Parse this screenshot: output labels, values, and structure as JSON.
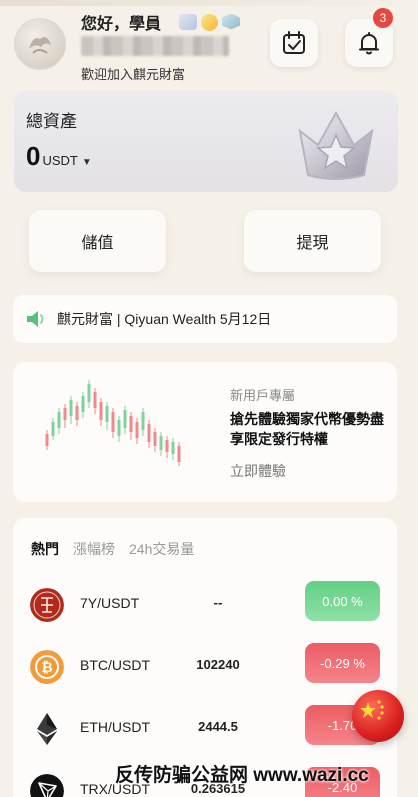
{
  "header": {
    "greeting": "您好，學員",
    "welcome": "歡迎加入麒元財富",
    "notification_count": "3"
  },
  "assets": {
    "label": "總資產",
    "value": "0",
    "unit": "USDT"
  },
  "actions": {
    "deposit_label": "儲值",
    "withdraw_label": "提現"
  },
  "announcement": {
    "text": "麒元財富 | Qiyuan Wealth 5月12日"
  },
  "promo": {
    "tag": "新用戶專屬",
    "title": "搶先體驗獨家代幣優勢盡享限定發行特權",
    "link": "立即體驗"
  },
  "market": {
    "tabs": [
      "熱門",
      "漲幅榜",
      "24h交易量"
    ],
    "rows": [
      {
        "pair": "7Y/USDT",
        "price": "--",
        "change": "0.00 %",
        "direction": "up",
        "icon": "7y-coin-icon"
      },
      {
        "pair": "BTC/USDT",
        "price": "102240",
        "change": "-0.29 %",
        "direction": "down",
        "icon": "btc-coin-icon"
      },
      {
        "pair": "ETH/USDT",
        "price": "2444.5",
        "change": "-1.70",
        "direction": "down",
        "icon": "eth-coin-icon"
      },
      {
        "pair": "TRX/USDT",
        "price": "0.263615",
        "change": "-2.40",
        "direction": "down",
        "icon": "trx-coin-icon"
      }
    ]
  },
  "watermark": "反传防骗公益网 www.wazi.cc",
  "colors": {
    "up": "#63cf85",
    "down": "#ec5c63",
    "badge": "#e5483f"
  }
}
